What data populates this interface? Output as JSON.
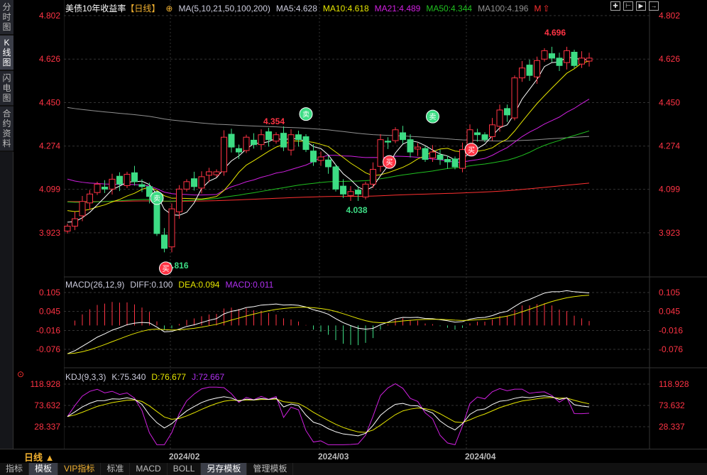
{
  "sidebar": {
    "items": [
      "分时图",
      "K线图",
      "闪电图",
      "合约资料"
    ]
  },
  "header": {
    "title": "美债10年收益率",
    "period": "【日线】",
    "ma_params": "MA(5,10,21,50,100,200)",
    "ma5": "MA5:4.628",
    "ma10": "MA10:4.618",
    "ma21": "MA21:4.489",
    "ma50": "MA50:4.344",
    "ma100": "MA100:4.196",
    "m_label": "M"
  },
  "macd": {
    "title": "MACD(26,12,9)",
    "diff": "DIFF:0.100",
    "dea": "DEA:0.094",
    "macd": "MACD:0.011",
    "ticks": [
      "0.105",
      "0.045",
      "-0.016",
      "-0.076"
    ]
  },
  "kdj": {
    "title": "KDJ(9,3,3)",
    "k": "K:75.340",
    "d": "D:76.677",
    "j": "J:72.667",
    "ticks": [
      "118.928",
      "73.632",
      "28.337"
    ]
  },
  "price_ticks": [
    "4.802",
    "4.626",
    "4.450",
    "4.274",
    "4.099",
    "3.923"
  ],
  "annotations": {
    "high": "4.696",
    "low": "3.816",
    "peak1": "4.354",
    "trough1": "4.038"
  },
  "signals": {
    "buy": "买",
    "sell": "卖"
  },
  "bottom": {
    "period": "日线 ▲",
    "dates": [
      "2024/02",
      "2024/03",
      "2024/04"
    ]
  },
  "tabs": [
    "指标",
    "模板",
    "VIP指标",
    "标准",
    "MACD",
    "BOLL",
    "另存模板",
    "管理模板"
  ],
  "colors": {
    "up": "#ff3344",
    "down": "#3ddc84",
    "ma5": "#ffffff",
    "ma10": "#e6e600",
    "ma21": "#d020e0",
    "ma50": "#20c020",
    "ma100": "#909090",
    "ma200": "#ff3030"
  },
  "chart_data": {
    "type": "candlestick",
    "closes": [
      3.95,
      3.98,
      4.05,
      4.08,
      4.12,
      4.1,
      4.14,
      4.12,
      4.16,
      4.13,
      4.11,
      4.07,
      3.92,
      3.86,
      4.02,
      4.1,
      4.13,
      4.11,
      4.15,
      4.17,
      4.17,
      4.31,
      4.27,
      4.25,
      4.31,
      4.28,
      4.32,
      4.3,
      4.32,
      4.27,
      4.32,
      4.3,
      4.26,
      4.21,
      4.23,
      4.19,
      4.1,
      4.08,
      4.09,
      4.08,
      4.12,
      4.18,
      4.3,
      4.29,
      4.34,
      4.3,
      4.25,
      4.27,
      4.22,
      4.25,
      4.22,
      4.21,
      4.19,
      4.26,
      4.34,
      4.32,
      4.3,
      4.36,
      4.42,
      4.4,
      4.55,
      4.59,
      4.56,
      4.62,
      4.66,
      4.63,
      4.6,
      4.66,
      4.6,
      4.63,
      4.63
    ],
    "signals": [
      {
        "i": 12,
        "type": "sell"
      },
      {
        "i": 13,
        "type": "buy"
      },
      {
        "i": 32,
        "type": "sell"
      },
      {
        "i": 43,
        "type": "buy"
      },
      {
        "i": 49,
        "type": "sell"
      },
      {
        "i": 54,
        "type": "buy"
      }
    ],
    "ylim": [
      3.8,
      4.83
    ]
  }
}
